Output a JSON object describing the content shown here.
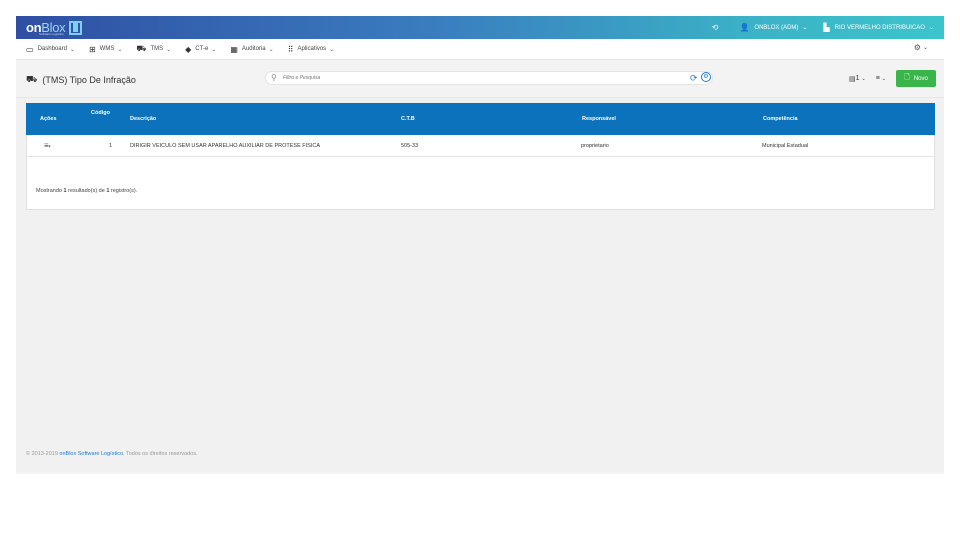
{
  "topbar": {
    "logo_on": "on",
    "logo_blox": "Blox",
    "logo_sub": "Software Logístico",
    "user": "ONBLOX (ADM)",
    "company": "RIO VERMELHO DISTRIBUICAO"
  },
  "menu": [
    {
      "label": "Dashboard",
      "icon": "monitor-icon"
    },
    {
      "label": "WMS",
      "icon": "grid-icon"
    },
    {
      "label": "TMS",
      "icon": "truck-icon"
    },
    {
      "label": "CT-e",
      "icon": "gem-icon"
    },
    {
      "label": "Auditoria",
      "icon": "building-icon"
    },
    {
      "label": "Aplicativos",
      "icon": "apps-icon"
    }
  ],
  "page": {
    "title": "(TMS) Tipo De Infração",
    "search_placeholder": "Filtro e Pesquisa",
    "page_size": "1",
    "new_label": "Novo"
  },
  "table": {
    "headers": {
      "acoes": "Ações",
      "codigo": "Código",
      "descricao": "Descrição",
      "ctb": "C.T.B",
      "responsavel": "Responsável",
      "competencia": "Competência"
    },
    "rows": [
      {
        "codigo": "1",
        "descricao": "DIRIGIR VEICULO SEM USAR APARELHO AUXILIAR DE PROTESE FISICA",
        "ctb": "505-33",
        "responsavel": "proprietario",
        "competencia": "Municipal Estadual"
      }
    ],
    "footer": {
      "prefix": "Mostrando ",
      "shown": "1",
      "middle": " resultado(s) de ",
      "total": "1",
      "suffix": " registro(s)."
    }
  },
  "copyright": {
    "prefix": "© 2013-2019 ",
    "link": "onBlox Software Logístico",
    "suffix": ". Todos os direitos reservados."
  },
  "colors": {
    "table_header": "#0b72bb",
    "new_button": "#3ab54a",
    "link": "#1e7ad6"
  }
}
